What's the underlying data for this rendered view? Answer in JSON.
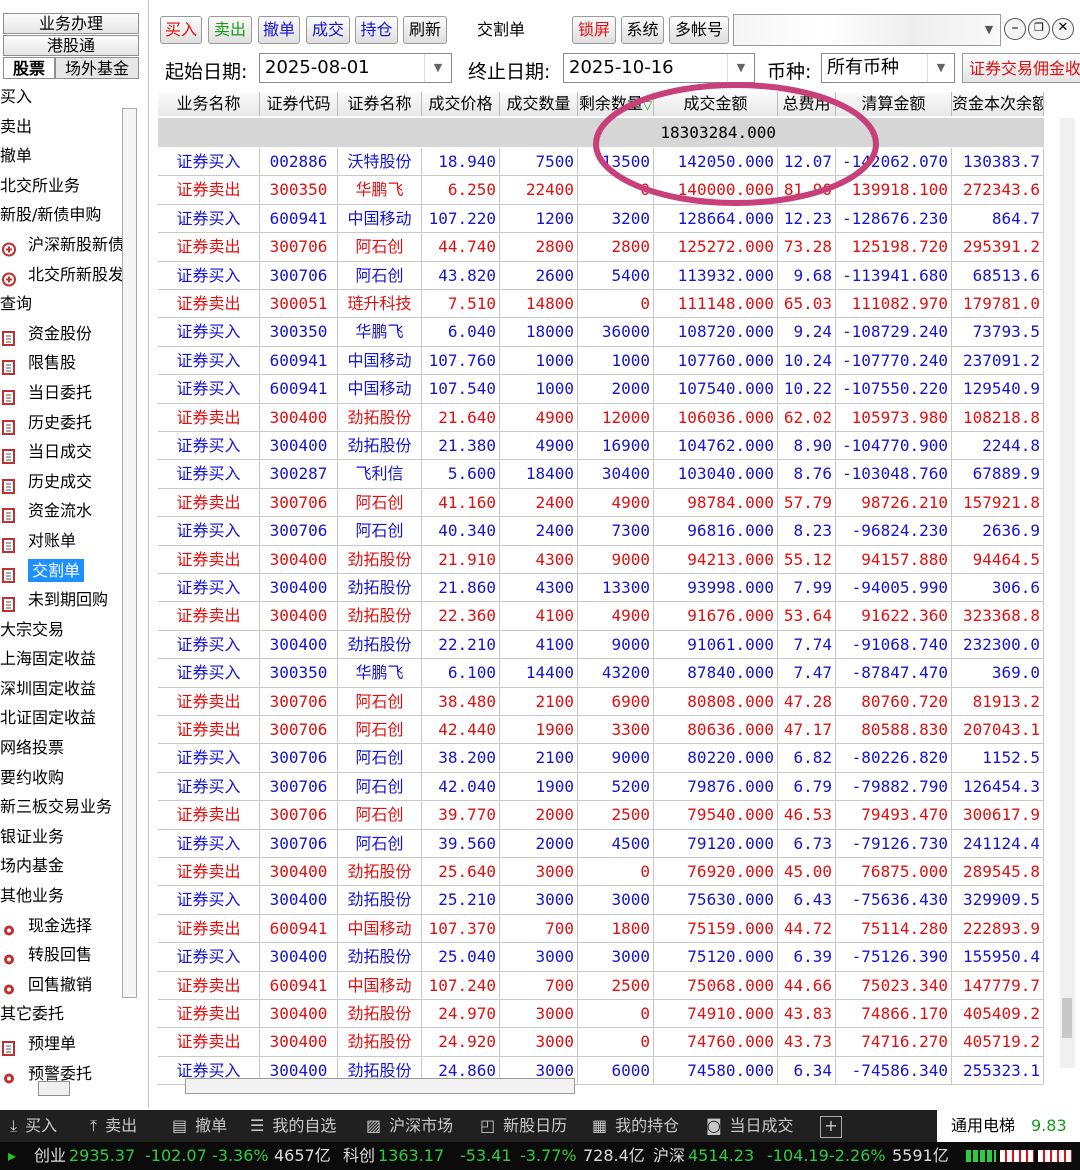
{
  "sidebar": {
    "top_tabs": [
      "业务办理",
      "港股通"
    ],
    "sub_tabs": [
      "股票",
      "场外基金"
    ],
    "items": [
      {
        "label": "买入",
        "level": 1,
        "icon": ""
      },
      {
        "label": "卖出",
        "level": 1,
        "icon": ""
      },
      {
        "label": "撤单",
        "level": 1,
        "icon": ""
      },
      {
        "label": "北交所业务",
        "level": 1,
        "icon": ""
      },
      {
        "label": "新股/新债申购",
        "level": 1,
        "icon": ""
      },
      {
        "label": "沪深新股新债",
        "level": 2,
        "icon": "plus-circle-icon"
      },
      {
        "label": "北交所新股发",
        "level": 2,
        "icon": "plus-circle-icon"
      },
      {
        "label": "查询",
        "level": 1,
        "icon": ""
      },
      {
        "label": "资金股份",
        "level": 2,
        "icon": "document-icon"
      },
      {
        "label": "限售股",
        "level": 2,
        "icon": "document-icon"
      },
      {
        "label": "当日委托",
        "level": 2,
        "icon": "document-icon"
      },
      {
        "label": "历史委托",
        "level": 2,
        "icon": "document-icon"
      },
      {
        "label": "当日成交",
        "level": 2,
        "icon": "document-icon"
      },
      {
        "label": "历史成交",
        "level": 2,
        "icon": "document-icon"
      },
      {
        "label": "资金流水",
        "level": 2,
        "icon": "document-icon"
      },
      {
        "label": "对账单",
        "level": 2,
        "icon": "document-icon"
      },
      {
        "label": "交割单",
        "level": 2,
        "icon": "document-icon",
        "selected": true
      },
      {
        "label": "未到期回购",
        "level": 2,
        "icon": "document-icon"
      },
      {
        "label": "大宗交易",
        "level": 1,
        "icon": ""
      },
      {
        "label": "上海固定收益",
        "level": 1,
        "icon": ""
      },
      {
        "label": "深圳固定收益",
        "level": 1,
        "icon": ""
      },
      {
        "label": "北证固定收益",
        "level": 1,
        "icon": ""
      },
      {
        "label": "网络投票",
        "level": 1,
        "icon": ""
      },
      {
        "label": "要约收购",
        "level": 1,
        "icon": ""
      },
      {
        "label": "新三板交易业务",
        "level": 1,
        "icon": ""
      },
      {
        "label": "银证业务",
        "level": 1,
        "icon": ""
      },
      {
        "label": "场内基金",
        "level": 1,
        "icon": ""
      },
      {
        "label": "其他业务",
        "level": 1,
        "icon": ""
      },
      {
        "label": "现金选择",
        "level": 2,
        "icon": "gear-icon"
      },
      {
        "label": "转股回售",
        "level": 2,
        "icon": "gear-icon"
      },
      {
        "label": "回售撤销",
        "level": 2,
        "icon": "gear-icon"
      },
      {
        "label": "其它委托",
        "level": 1,
        "icon": ""
      },
      {
        "label": "预埋单",
        "level": 2,
        "icon": "document-icon"
      },
      {
        "label": "预警委托",
        "level": 2,
        "icon": "gear-icon"
      }
    ]
  },
  "toolbar": {
    "buy": "买入",
    "sell": "卖出",
    "cancel": "撤单",
    "deal": "成交",
    "position": "持仓",
    "refresh": "刷新",
    "title": "交割单",
    "lock": "锁屏",
    "system": "系统",
    "multi": "多帐号"
  },
  "filters": {
    "start_label": "起始日期:",
    "start_value": "2025-08-01",
    "end_label": "终止日期:",
    "end_value": "2025-10-16",
    "currency_label": "币种:",
    "currency_value": "所有币种",
    "commission_link": "证券交易佣金收"
  },
  "table": {
    "headers": [
      "业务名称",
      "证券代码",
      "证券名称",
      "成交价格",
      "成交数量",
      "剩余数量",
      "成交金额",
      "总费用",
      "清算金额",
      "资金本次余额"
    ],
    "sort_indicator": "▽",
    "summary_amount": "18303284.000",
    "rows": [
      [
        "证券买入",
        "002886",
        "沃特股份",
        "18.940",
        "7500",
        "13500",
        "142050.000",
        "12.07",
        "-142062.070",
        "130383.7"
      ],
      [
        "证券卖出",
        "300350",
        "华鹏飞",
        "6.250",
        "22400",
        "0",
        "140000.000",
        "81.90",
        "139918.100",
        "272343.6"
      ],
      [
        "证券买入",
        "600941",
        "中国移动",
        "107.220",
        "1200",
        "3200",
        "128664.000",
        "12.23",
        "-128676.230",
        "864.7"
      ],
      [
        "证券卖出",
        "300706",
        "阿石创",
        "44.740",
        "2800",
        "2800",
        "125272.000",
        "73.28",
        "125198.720",
        "295391.2"
      ],
      [
        "证券买入",
        "300706",
        "阿石创",
        "43.820",
        "2600",
        "5400",
        "113932.000",
        "9.68",
        "-113941.680",
        "68513.6"
      ],
      [
        "证券卖出",
        "300051",
        "琏升科技",
        "7.510",
        "14800",
        "0",
        "111148.000",
        "65.03",
        "111082.970",
        "179781.0"
      ],
      [
        "证券买入",
        "300350",
        "华鹏飞",
        "6.040",
        "18000",
        "36000",
        "108720.000",
        "9.24",
        "-108729.240",
        "73793.5"
      ],
      [
        "证券买入",
        "600941",
        "中国移动",
        "107.760",
        "1000",
        "1000",
        "107760.000",
        "10.24",
        "-107770.240",
        "237091.2"
      ],
      [
        "证券买入",
        "600941",
        "中国移动",
        "107.540",
        "1000",
        "2000",
        "107540.000",
        "10.22",
        "-107550.220",
        "129540.9"
      ],
      [
        "证券卖出",
        "300400",
        "劲拓股份",
        "21.640",
        "4900",
        "12000",
        "106036.000",
        "62.02",
        "105973.980",
        "108218.8"
      ],
      [
        "证券买入",
        "300400",
        "劲拓股份",
        "21.380",
        "4900",
        "16900",
        "104762.000",
        "8.90",
        "-104770.900",
        "2244.8"
      ],
      [
        "证券买入",
        "300287",
        "飞利信",
        "5.600",
        "18400",
        "30400",
        "103040.000",
        "8.76",
        "-103048.760",
        "67889.9"
      ],
      [
        "证券卖出",
        "300706",
        "阿石创",
        "41.160",
        "2400",
        "4900",
        "98784.000",
        "57.79",
        "98726.210",
        "157921.8"
      ],
      [
        "证券买入",
        "300706",
        "阿石创",
        "40.340",
        "2400",
        "7300",
        "96816.000",
        "8.23",
        "-96824.230",
        "2636.9"
      ],
      [
        "证券卖出",
        "300400",
        "劲拓股份",
        "21.910",
        "4300",
        "9000",
        "94213.000",
        "55.12",
        "94157.880",
        "94464.5"
      ],
      [
        "证券买入",
        "300400",
        "劲拓股份",
        "21.860",
        "4300",
        "13300",
        "93998.000",
        "7.99",
        "-94005.990",
        "306.6"
      ],
      [
        "证券卖出",
        "300400",
        "劲拓股份",
        "22.360",
        "4100",
        "4900",
        "91676.000",
        "53.64",
        "91622.360",
        "323368.8"
      ],
      [
        "证券买入",
        "300400",
        "劲拓股份",
        "22.210",
        "4100",
        "9000",
        "91061.000",
        "7.74",
        "-91068.740",
        "232300.0"
      ],
      [
        "证券买入",
        "300350",
        "华鹏飞",
        "6.100",
        "14400",
        "43200",
        "87840.000",
        "7.47",
        "-87847.470",
        "369.0"
      ],
      [
        "证券卖出",
        "300706",
        "阿石创",
        "38.480",
        "2100",
        "6900",
        "80808.000",
        "47.28",
        "80760.720",
        "81913.2"
      ],
      [
        "证券卖出",
        "300706",
        "阿石创",
        "42.440",
        "1900",
        "3300",
        "80636.000",
        "47.17",
        "80588.830",
        "207043.1"
      ],
      [
        "证券买入",
        "300706",
        "阿石创",
        "38.200",
        "2100",
        "9000",
        "80220.000",
        "6.82",
        "-80226.820",
        "1152.5"
      ],
      [
        "证券买入",
        "300706",
        "阿石创",
        "42.040",
        "1900",
        "5200",
        "79876.000",
        "6.79",
        "-79882.790",
        "126454.3"
      ],
      [
        "证券卖出",
        "300706",
        "阿石创",
        "39.770",
        "2000",
        "2500",
        "79540.000",
        "46.53",
        "79493.470",
        "300617.9"
      ],
      [
        "证券买入",
        "300706",
        "阿石创",
        "39.560",
        "2000",
        "4500",
        "79120.000",
        "6.73",
        "-79126.730",
        "241124.4"
      ],
      [
        "证券卖出",
        "300400",
        "劲拓股份",
        "25.640",
        "3000",
        "0",
        "76920.000",
        "45.00",
        "76875.000",
        "289545.8"
      ],
      [
        "证券买入",
        "300400",
        "劲拓股份",
        "25.210",
        "3000",
        "3000",
        "75630.000",
        "6.43",
        "-75636.430",
        "329909.5"
      ],
      [
        "证券卖出",
        "600941",
        "中国移动",
        "107.370",
        "700",
        "1800",
        "75159.000",
        "44.72",
        "75114.280",
        "222893.9"
      ],
      [
        "证券买入",
        "300400",
        "劲拓股份",
        "25.040",
        "3000",
        "3000",
        "75120.000",
        "6.39",
        "-75126.390",
        "155950.4"
      ],
      [
        "证券卖出",
        "600941",
        "中国移动",
        "107.240",
        "700",
        "2500",
        "75068.000",
        "44.66",
        "75023.340",
        "147779.7"
      ],
      [
        "证券卖出",
        "300400",
        "劲拓股份",
        "24.970",
        "3000",
        "0",
        "74910.000",
        "43.83",
        "74866.170",
        "405409.2"
      ],
      [
        "证券卖出",
        "300400",
        "劲拓股份",
        "24.920",
        "3000",
        "0",
        "74760.000",
        "43.73",
        "74716.270",
        "405719.2"
      ],
      [
        "证券买入",
        "300400",
        "劲拓股份",
        "24.860",
        "3000",
        "6000",
        "74580.000",
        "6.34",
        "-74586.340",
        "255323.1"
      ]
    ],
    "colors": {
      "buy": "#1515d0",
      "sell": "#e01010"
    }
  },
  "bottom_bar": {
    "items": [
      "买入",
      "卖出",
      "撤单",
      "我的自选",
      "沪深市场",
      "新股日历",
      "我的持仓",
      "当日成交"
    ],
    "plus": "+",
    "stock_name": "通用电梯",
    "stock_price": "9.83"
  },
  "ticker": {
    "chuangye": {
      "name": "创业",
      "value": "2935.37",
      "change": "-102.07",
      "pct": "-3.36%",
      "volume": "4657亿"
    },
    "kechuang": {
      "name": "科创",
      "value": "1363.17",
      "change": "-53.41",
      "pct": "-3.77%",
      "volume": "728.4亿"
    },
    "hushen": {
      "name": "沪深",
      "value": "4514.23",
      "change": "-104.19",
      "pct": "-2.26%",
      "volume": "5591亿"
    }
  },
  "annotation_color": "#c8407a"
}
